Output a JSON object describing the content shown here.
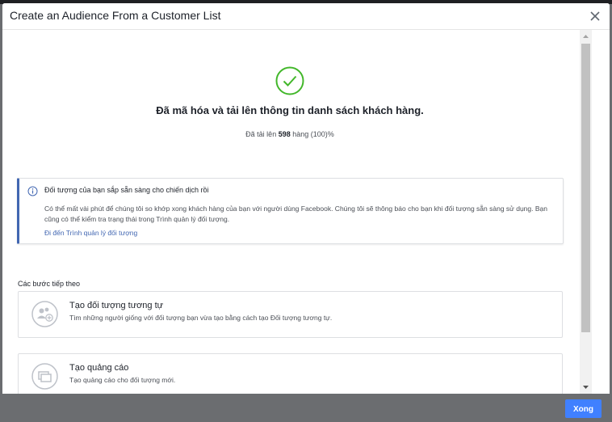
{
  "modal": {
    "title": "Create an Audience From a Customer List",
    "done_label": "Xong"
  },
  "success": {
    "title": "Đã mã hóa và tải lên thông tin danh sách khách hàng.",
    "count_prefix": "Đã tải lên",
    "count_value": "598",
    "count_suffix": "hàng (100)%"
  },
  "info": {
    "title": "Đối tượng của bạn sắp sẵn sàng cho chiến dịch rồi",
    "body": "Có thể mất vài phút để chúng tôi so khớp xong khách hàng của bạn với người dùng Facebook. Chúng tôi sẽ thông báo cho bạn khi đối tượng sẵn sàng sử dụng. Bạn cũng có thể kiểm tra trạng thái trong Trình quản lý đối tượng.",
    "link": "Đi đến Trình quản lý đối tượng"
  },
  "next_steps": {
    "label": "Các bước tiếp theo",
    "items": [
      {
        "title": "Tạo đối tượng tương tự",
        "desc": "Tìm những người giống với đối tượng bạn vừa tạo bằng cách tạo Đối tượng tương tự.",
        "icon": "lookalike-audience-icon"
      },
      {
        "title": "Tạo quảng cáo",
        "desc": "Tạo quảng cáo cho đối tượng mới.",
        "icon": "create-ad-icon"
      }
    ]
  },
  "colors": {
    "accent": "#4080ff",
    "success_green": "#42b72a",
    "link_blue": "#4267b2"
  }
}
